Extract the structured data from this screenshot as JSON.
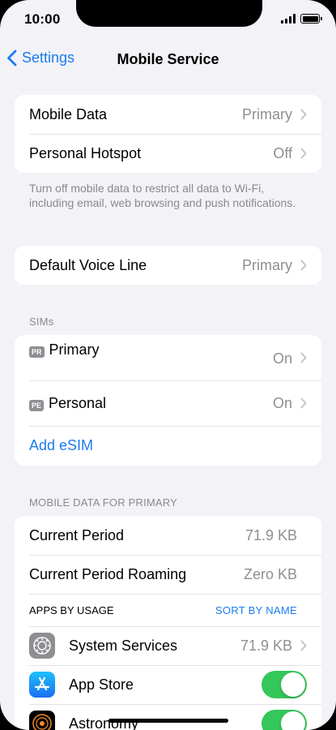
{
  "status": {
    "time": "10:00"
  },
  "nav": {
    "back_label": "Settings",
    "title": "Mobile Service"
  },
  "group1": {
    "mobile_data": {
      "label": "Mobile Data",
      "value": "Primary"
    },
    "hotspot": {
      "label": "Personal Hotspot",
      "value": "Off"
    }
  },
  "footnote": "Turn off mobile data to restrict all data to Wi-Fi, including email, web browsing and push notifications.",
  "voice": {
    "label": "Default Voice Line",
    "value": "Primary"
  },
  "sims": {
    "header": "SIMs",
    "items": [
      {
        "badge": "PR",
        "label": "Primary",
        "value": "On"
      },
      {
        "badge": "PE",
        "label": "Personal",
        "value": "On"
      }
    ],
    "add_label": "Add eSIM"
  },
  "usage": {
    "header": "MOBILE DATA FOR PRIMARY",
    "current_period": {
      "label": "Current Period",
      "value": "71.9 KB"
    },
    "roaming": {
      "label": "Current Period Roaming",
      "value": "Zero KB"
    },
    "apps_header": "APPS BY USAGE",
    "sort_label": "SORT BY NAME",
    "apps": [
      {
        "label": "System Services",
        "value": "71.9 KB",
        "icon": "gear-icon"
      },
      {
        "label": "App Store",
        "icon": "app-store-icon",
        "enabled": true
      },
      {
        "label": "Astronomy",
        "icon": "astronomy-icon",
        "enabled": true
      }
    ]
  },
  "colors": {
    "accent": "#1a7cf0",
    "toggle_on": "#34c759"
  }
}
